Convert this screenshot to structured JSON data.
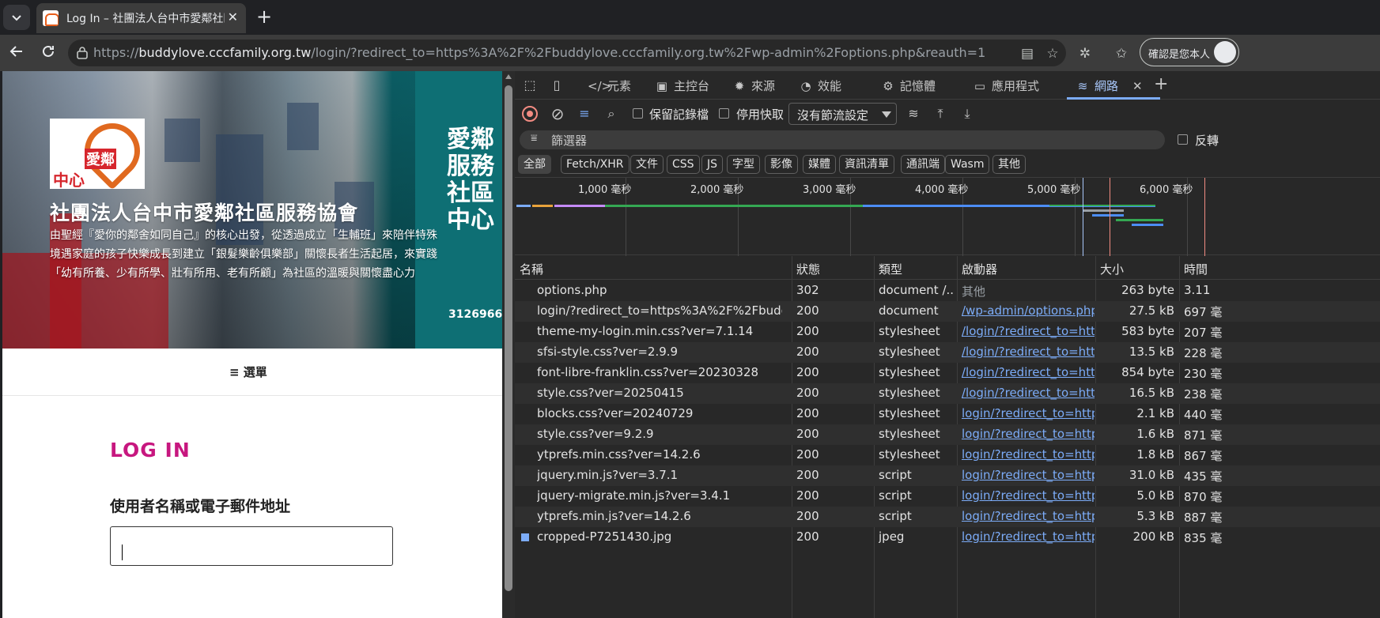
{
  "browser": {
    "tab_title": "Log In – 社團法人台中市愛鄰社區服務協會",
    "url_scheme": "https://",
    "url_host": "buddylove.cccfamily.org.tw",
    "url_path": "/login/?redirect_to=https%3A%2F%2Fbuddylove.cccfamily.org.tw%2Fwp-admin%2Foptions.php&reauth=1",
    "profile_label": "確認是您本人"
  },
  "page": {
    "logo_top": "愛鄰",
    "logo_bottom": "中心",
    "site_title": "社團法人台中市愛鄰社區服務協會",
    "site_description": "由聖經『愛你的鄰舍如同自己』的核心出發，從透過成立「生輔班」來陪伴特殊境遇家庭的孩子快樂成長到建立「銀髮樂齡俱樂部」關懷長者生活起居，來實踐「幼有所養、少有所學、壯有所用、老有所顧」為社區的溫暖與關懷盡心力",
    "sign_text": "愛鄰服務社區中心",
    "sign_phone": "3126966",
    "menu_label": "選單",
    "login_title": "LOG IN",
    "username_label": "使用者名稱或電子郵件地址",
    "username_value": ""
  },
  "devtools": {
    "tabs": [
      "元素",
      "主控台",
      "來源",
      "效能",
      "記憶體",
      "應用程式",
      "網路"
    ],
    "active_tab": "網路",
    "toolbar": {
      "preserve_log": "保留記錄檔",
      "disable_cache": "停用快取",
      "throttling": "沒有節流設定"
    },
    "filter_placeholder": "篩選器",
    "invert_label": "反轉",
    "type_filters": [
      "全部",
      "Fetch/XHR",
      "文件",
      "CSS",
      "JS",
      "字型",
      "影像",
      "媒體",
      "資訊清單",
      "通訊端",
      "Wasm",
      "其他"
    ],
    "timeline_ticks": [
      "1,000 毫秒",
      "2,000 毫秒",
      "3,000 毫秒",
      "4,000 毫秒",
      "5,000 毫秒",
      "6,000 毫秒"
    ],
    "columns": [
      "名稱",
      "狀態",
      "類型",
      "啟動器",
      "大小",
      "時間"
    ],
    "requests": [
      {
        "name": "options.php",
        "status": "302",
        "type": "document /...",
        "initiator": "其他",
        "size": "263 byte",
        "time": "3.11"
      },
      {
        "name": "login/?redirect_to=https%3A%2F%2Fbudd...",
        "status": "200",
        "type": "document",
        "initiator": "/wp-admin/options.php",
        "size": "27.5 kB",
        "time": "697 毫"
      },
      {
        "name": "theme-my-login.min.css?ver=7.1.14",
        "status": "200",
        "type": "stylesheet",
        "initiator": "/login/?redirect_to=http",
        "size": "583 byte",
        "time": "207 毫"
      },
      {
        "name": "sfsi-style.css?ver=2.9.9",
        "status": "200",
        "type": "stylesheet",
        "initiator": "/login/?redirect_to=http",
        "size": "13.5 kB",
        "time": "228 毫"
      },
      {
        "name": "font-libre-franklin.css?ver=20230328",
        "status": "200",
        "type": "stylesheet",
        "initiator": "/login/?redirect_to=http",
        "size": "854 byte",
        "time": "230 毫"
      },
      {
        "name": "style.css?ver=20250415",
        "status": "200",
        "type": "stylesheet",
        "initiator": "/login/?redirect_to=http",
        "size": "16.5 kB",
        "time": "238 毫"
      },
      {
        "name": "blocks.css?ver=20240729",
        "status": "200",
        "type": "stylesheet",
        "initiator": "login/?redirect_to=https",
        "size": "2.1 kB",
        "time": "440 毫"
      },
      {
        "name": "style.css?ver=9.2.9",
        "status": "200",
        "type": "stylesheet",
        "initiator": "login/?redirect_to=https",
        "size": "1.6 kB",
        "time": "871 毫"
      },
      {
        "name": "ytprefs.min.css?ver=14.2.6",
        "status": "200",
        "type": "stylesheet",
        "initiator": "login/?redirect_to=https",
        "size": "1.8 kB",
        "time": "867 毫"
      },
      {
        "name": "jquery.min.js?ver=3.7.1",
        "status": "200",
        "type": "script",
        "initiator": "login/?redirect_to=https",
        "size": "31.0 kB",
        "time": "435 毫"
      },
      {
        "name": "jquery-migrate.min.js?ver=3.4.1",
        "status": "200",
        "type": "script",
        "initiator": "login/?redirect_to=https",
        "size": "5.0 kB",
        "time": "870 毫"
      },
      {
        "name": "ytprefs.min.js?ver=14.2.6",
        "status": "200",
        "type": "script",
        "initiator": "login/?redirect_to=https",
        "size": "5.3 kB",
        "time": "887 毫"
      },
      {
        "name": "cropped-P7251430.jpg",
        "status": "200",
        "type": "jpeg",
        "initiator": "login/?redirect_to=https",
        "size": "200 kB",
        "time": "835 毫"
      }
    ]
  }
}
